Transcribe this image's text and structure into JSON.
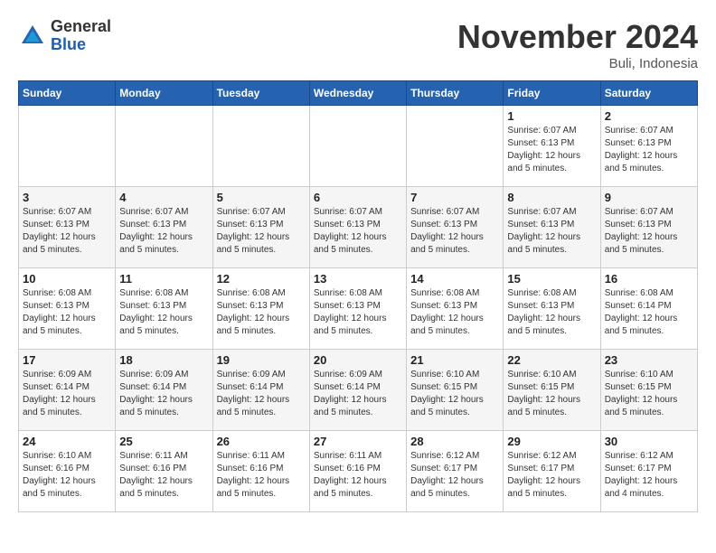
{
  "logo": {
    "general": "General",
    "blue": "Blue"
  },
  "title": "November 2024",
  "location": "Buli, Indonesia",
  "days_of_week": [
    "Sunday",
    "Monday",
    "Tuesday",
    "Wednesday",
    "Thursday",
    "Friday",
    "Saturday"
  ],
  "weeks": [
    [
      {
        "day": "",
        "info": ""
      },
      {
        "day": "",
        "info": ""
      },
      {
        "day": "",
        "info": ""
      },
      {
        "day": "",
        "info": ""
      },
      {
        "day": "",
        "info": ""
      },
      {
        "day": "1",
        "info": "Sunrise: 6:07 AM\nSunset: 6:13 PM\nDaylight: 12 hours\nand 5 minutes."
      },
      {
        "day": "2",
        "info": "Sunrise: 6:07 AM\nSunset: 6:13 PM\nDaylight: 12 hours\nand 5 minutes."
      }
    ],
    [
      {
        "day": "3",
        "info": "Sunrise: 6:07 AM\nSunset: 6:13 PM\nDaylight: 12 hours\nand 5 minutes."
      },
      {
        "day": "4",
        "info": "Sunrise: 6:07 AM\nSunset: 6:13 PM\nDaylight: 12 hours\nand 5 minutes."
      },
      {
        "day": "5",
        "info": "Sunrise: 6:07 AM\nSunset: 6:13 PM\nDaylight: 12 hours\nand 5 minutes."
      },
      {
        "day": "6",
        "info": "Sunrise: 6:07 AM\nSunset: 6:13 PM\nDaylight: 12 hours\nand 5 minutes."
      },
      {
        "day": "7",
        "info": "Sunrise: 6:07 AM\nSunset: 6:13 PM\nDaylight: 12 hours\nand 5 minutes."
      },
      {
        "day": "8",
        "info": "Sunrise: 6:07 AM\nSunset: 6:13 PM\nDaylight: 12 hours\nand 5 minutes."
      },
      {
        "day": "9",
        "info": "Sunrise: 6:07 AM\nSunset: 6:13 PM\nDaylight: 12 hours\nand 5 minutes."
      }
    ],
    [
      {
        "day": "10",
        "info": "Sunrise: 6:08 AM\nSunset: 6:13 PM\nDaylight: 12 hours\nand 5 minutes."
      },
      {
        "day": "11",
        "info": "Sunrise: 6:08 AM\nSunset: 6:13 PM\nDaylight: 12 hours\nand 5 minutes."
      },
      {
        "day": "12",
        "info": "Sunrise: 6:08 AM\nSunset: 6:13 PM\nDaylight: 12 hours\nand 5 minutes."
      },
      {
        "day": "13",
        "info": "Sunrise: 6:08 AM\nSunset: 6:13 PM\nDaylight: 12 hours\nand 5 minutes."
      },
      {
        "day": "14",
        "info": "Sunrise: 6:08 AM\nSunset: 6:13 PM\nDaylight: 12 hours\nand 5 minutes."
      },
      {
        "day": "15",
        "info": "Sunrise: 6:08 AM\nSunset: 6:13 PM\nDaylight: 12 hours\nand 5 minutes."
      },
      {
        "day": "16",
        "info": "Sunrise: 6:08 AM\nSunset: 6:14 PM\nDaylight: 12 hours\nand 5 minutes."
      }
    ],
    [
      {
        "day": "17",
        "info": "Sunrise: 6:09 AM\nSunset: 6:14 PM\nDaylight: 12 hours\nand 5 minutes."
      },
      {
        "day": "18",
        "info": "Sunrise: 6:09 AM\nSunset: 6:14 PM\nDaylight: 12 hours\nand 5 minutes."
      },
      {
        "day": "19",
        "info": "Sunrise: 6:09 AM\nSunset: 6:14 PM\nDaylight: 12 hours\nand 5 minutes."
      },
      {
        "day": "20",
        "info": "Sunrise: 6:09 AM\nSunset: 6:14 PM\nDaylight: 12 hours\nand 5 minutes."
      },
      {
        "day": "21",
        "info": "Sunrise: 6:10 AM\nSunset: 6:15 PM\nDaylight: 12 hours\nand 5 minutes."
      },
      {
        "day": "22",
        "info": "Sunrise: 6:10 AM\nSunset: 6:15 PM\nDaylight: 12 hours\nand 5 minutes."
      },
      {
        "day": "23",
        "info": "Sunrise: 6:10 AM\nSunset: 6:15 PM\nDaylight: 12 hours\nand 5 minutes."
      }
    ],
    [
      {
        "day": "24",
        "info": "Sunrise: 6:10 AM\nSunset: 6:16 PM\nDaylight: 12 hours\nand 5 minutes."
      },
      {
        "day": "25",
        "info": "Sunrise: 6:11 AM\nSunset: 6:16 PM\nDaylight: 12 hours\nand 5 minutes."
      },
      {
        "day": "26",
        "info": "Sunrise: 6:11 AM\nSunset: 6:16 PM\nDaylight: 12 hours\nand 5 minutes."
      },
      {
        "day": "27",
        "info": "Sunrise: 6:11 AM\nSunset: 6:16 PM\nDaylight: 12 hours\nand 5 minutes."
      },
      {
        "day": "28",
        "info": "Sunrise: 6:12 AM\nSunset: 6:17 PM\nDaylight: 12 hours\nand 5 minutes."
      },
      {
        "day": "29",
        "info": "Sunrise: 6:12 AM\nSunset: 6:17 PM\nDaylight: 12 hours\nand 5 minutes."
      },
      {
        "day": "30",
        "info": "Sunrise: 6:12 AM\nSunset: 6:17 PM\nDaylight: 12 hours\nand 4 minutes."
      }
    ]
  ]
}
